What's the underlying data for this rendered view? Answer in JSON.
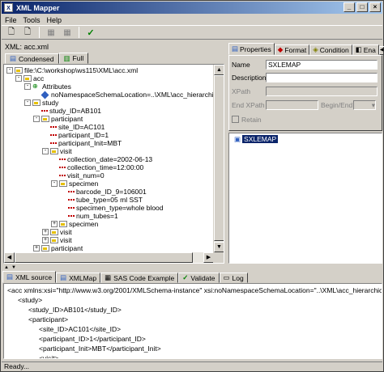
{
  "window": {
    "title": "XML Mapper",
    "app_icon": "X"
  },
  "menu": [
    "File",
    "Tools",
    "Help"
  ],
  "toolbar": {
    "buttons": [
      {
        "name": "open-xml-button",
        "icon": "open-doc-icon",
        "glyph": "🗋"
      },
      {
        "name": "open-map-button",
        "icon": "open-map-icon",
        "glyph": "🗋"
      },
      {
        "name": "save-button",
        "icon": "save-icon",
        "glyph": "▦",
        "disabled": true
      },
      {
        "name": "save-as-button",
        "icon": "save-as-icon",
        "glyph": "▦",
        "disabled": true
      },
      {
        "name": "validate-button",
        "icon": "check-icon",
        "glyph": "✓"
      }
    ]
  },
  "left": {
    "title": "XML: acc.xml",
    "tabs": [
      {
        "label": "Condensed"
      },
      {
        "label": "Full"
      }
    ],
    "tree": [
      {
        "d": 0,
        "pm": "-",
        "icon": "folder",
        "text": "file:\\C:\\workshop\\ws115\\XML\\acc.xml"
      },
      {
        "d": 1,
        "pm": "-",
        "icon": "folder",
        "text": "acc"
      },
      {
        "d": 2,
        "pm": "-",
        "icon": "attrs",
        "text": "Attributes"
      },
      {
        "d": 3,
        "pm": "",
        "icon": "diamond",
        "text": "noNamespaceSchemaLocation=..\\XML\\acc_hierarchical.xsd"
      },
      {
        "d": 2,
        "pm": "-",
        "icon": "folder",
        "text": "study"
      },
      {
        "d": 3,
        "pm": "",
        "icon": "leaf",
        "text": "study_ID=AB101"
      },
      {
        "d": 3,
        "pm": "-",
        "icon": "folder",
        "text": "participant"
      },
      {
        "d": 4,
        "pm": "",
        "icon": "leaf",
        "text": "site_ID=AC101"
      },
      {
        "d": 4,
        "pm": "",
        "icon": "leaf",
        "text": "participant_ID=1"
      },
      {
        "d": 4,
        "pm": "",
        "icon": "leaf",
        "text": "participant_Init=MBT"
      },
      {
        "d": 4,
        "pm": "-",
        "icon": "folder",
        "text": "visit"
      },
      {
        "d": 5,
        "pm": "",
        "icon": "leaf",
        "text": "collection_date=2002-06-13"
      },
      {
        "d": 5,
        "pm": "",
        "icon": "leaf",
        "text": "collection_time=12:00:00"
      },
      {
        "d": 5,
        "pm": "",
        "icon": "leaf",
        "text": "visit_num=0"
      },
      {
        "d": 5,
        "pm": "-",
        "icon": "folder",
        "text": "specimen"
      },
      {
        "d": 6,
        "pm": "",
        "icon": "leaf",
        "text": "barcode_ID_9=106001"
      },
      {
        "d": 6,
        "pm": "",
        "icon": "leaf",
        "text": "tube_type=05 ml SST"
      },
      {
        "d": 6,
        "pm": "",
        "icon": "leaf",
        "text": "specimen_type=whole blood"
      },
      {
        "d": 6,
        "pm": "",
        "icon": "leaf",
        "text": "num_tubes=1"
      },
      {
        "d": 5,
        "pm": "+",
        "icon": "folder",
        "text": "specimen"
      },
      {
        "d": 4,
        "pm": "+",
        "icon": "folder",
        "text": "visit"
      },
      {
        "d": 4,
        "pm": "+",
        "icon": "folder",
        "text": "visit"
      },
      {
        "d": 3,
        "pm": "+",
        "icon": "folder",
        "text": "participant"
      }
    ]
  },
  "right": {
    "tabs": [
      {
        "label": "Properties"
      },
      {
        "label": "Format"
      },
      {
        "label": "Condition"
      },
      {
        "label": "Ena"
      }
    ],
    "props": {
      "name_label": "Name",
      "name_value": "SXLEMAP",
      "desc_label": "Description",
      "desc_value": "",
      "xpath_label": "XPath",
      "endxpath_label": "End XPath",
      "begin_end_label": "Begin/End",
      "retain_label": "Retain"
    },
    "outline_item": "SXLEMAP"
  },
  "bottom": {
    "tabs": [
      {
        "label": "XML source"
      },
      {
        "label": "XMLMap"
      },
      {
        "label": "SAS Code Example"
      },
      {
        "label": "Validate"
      },
      {
        "label": "Log"
      }
    ],
    "source": [
      {
        "i": 0,
        "t": "<acc xmlns:xsi=\"http://www.w3.org/2001/XMLSchema-instance\" xsi:noNamespaceSchemaLocation=\"..\\XML\\acc_hierarchical.xsd\">"
      },
      {
        "i": 1,
        "t": "<study>"
      },
      {
        "i": 2,
        "t": "<study_ID>AB101</study_ID>"
      },
      {
        "i": 2,
        "t": "<participant>"
      },
      {
        "i": 3,
        "t": "<site_ID>AC101</site_ID>"
      },
      {
        "i": 3,
        "t": "<participant_ID>1</participant_ID>"
      },
      {
        "i": 3,
        "t": "<participant_Init>MBT</participant_Init>"
      },
      {
        "i": 3,
        "t": "<visit>"
      }
    ]
  },
  "status": "Ready..."
}
